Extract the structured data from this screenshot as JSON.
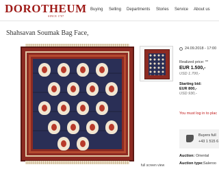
{
  "header": {
    "logo": "DOROTHEUM",
    "logo_sub": "SINCE 1707",
    "nav": [
      "Buying",
      "Selling",
      "Departments",
      "Stories",
      "Service",
      "About us"
    ]
  },
  "lot": {
    "title": "Shahsavan Soumak Bag Face,",
    "full_screen": "full screen view",
    "date": "24.09.2018 - 17:00",
    "realized_label": "Realized price: **",
    "realized_eur": "EUR 1.500,-",
    "realized_usd": "USD 1.700,-",
    "starting_label": "Starting bid:",
    "starting_eur": "EUR 800,-",
    "starting_usd": "USD 930,-",
    "login_notice": "You must log in to plac",
    "buyers_label": "Buyers full",
    "buyers_phone": "+43 1 515 6",
    "auction_label": "Auction:",
    "auction_value": "Oriental",
    "auction_type_label": "Auction type:",
    "auction_type_value": "Saleroo"
  }
}
